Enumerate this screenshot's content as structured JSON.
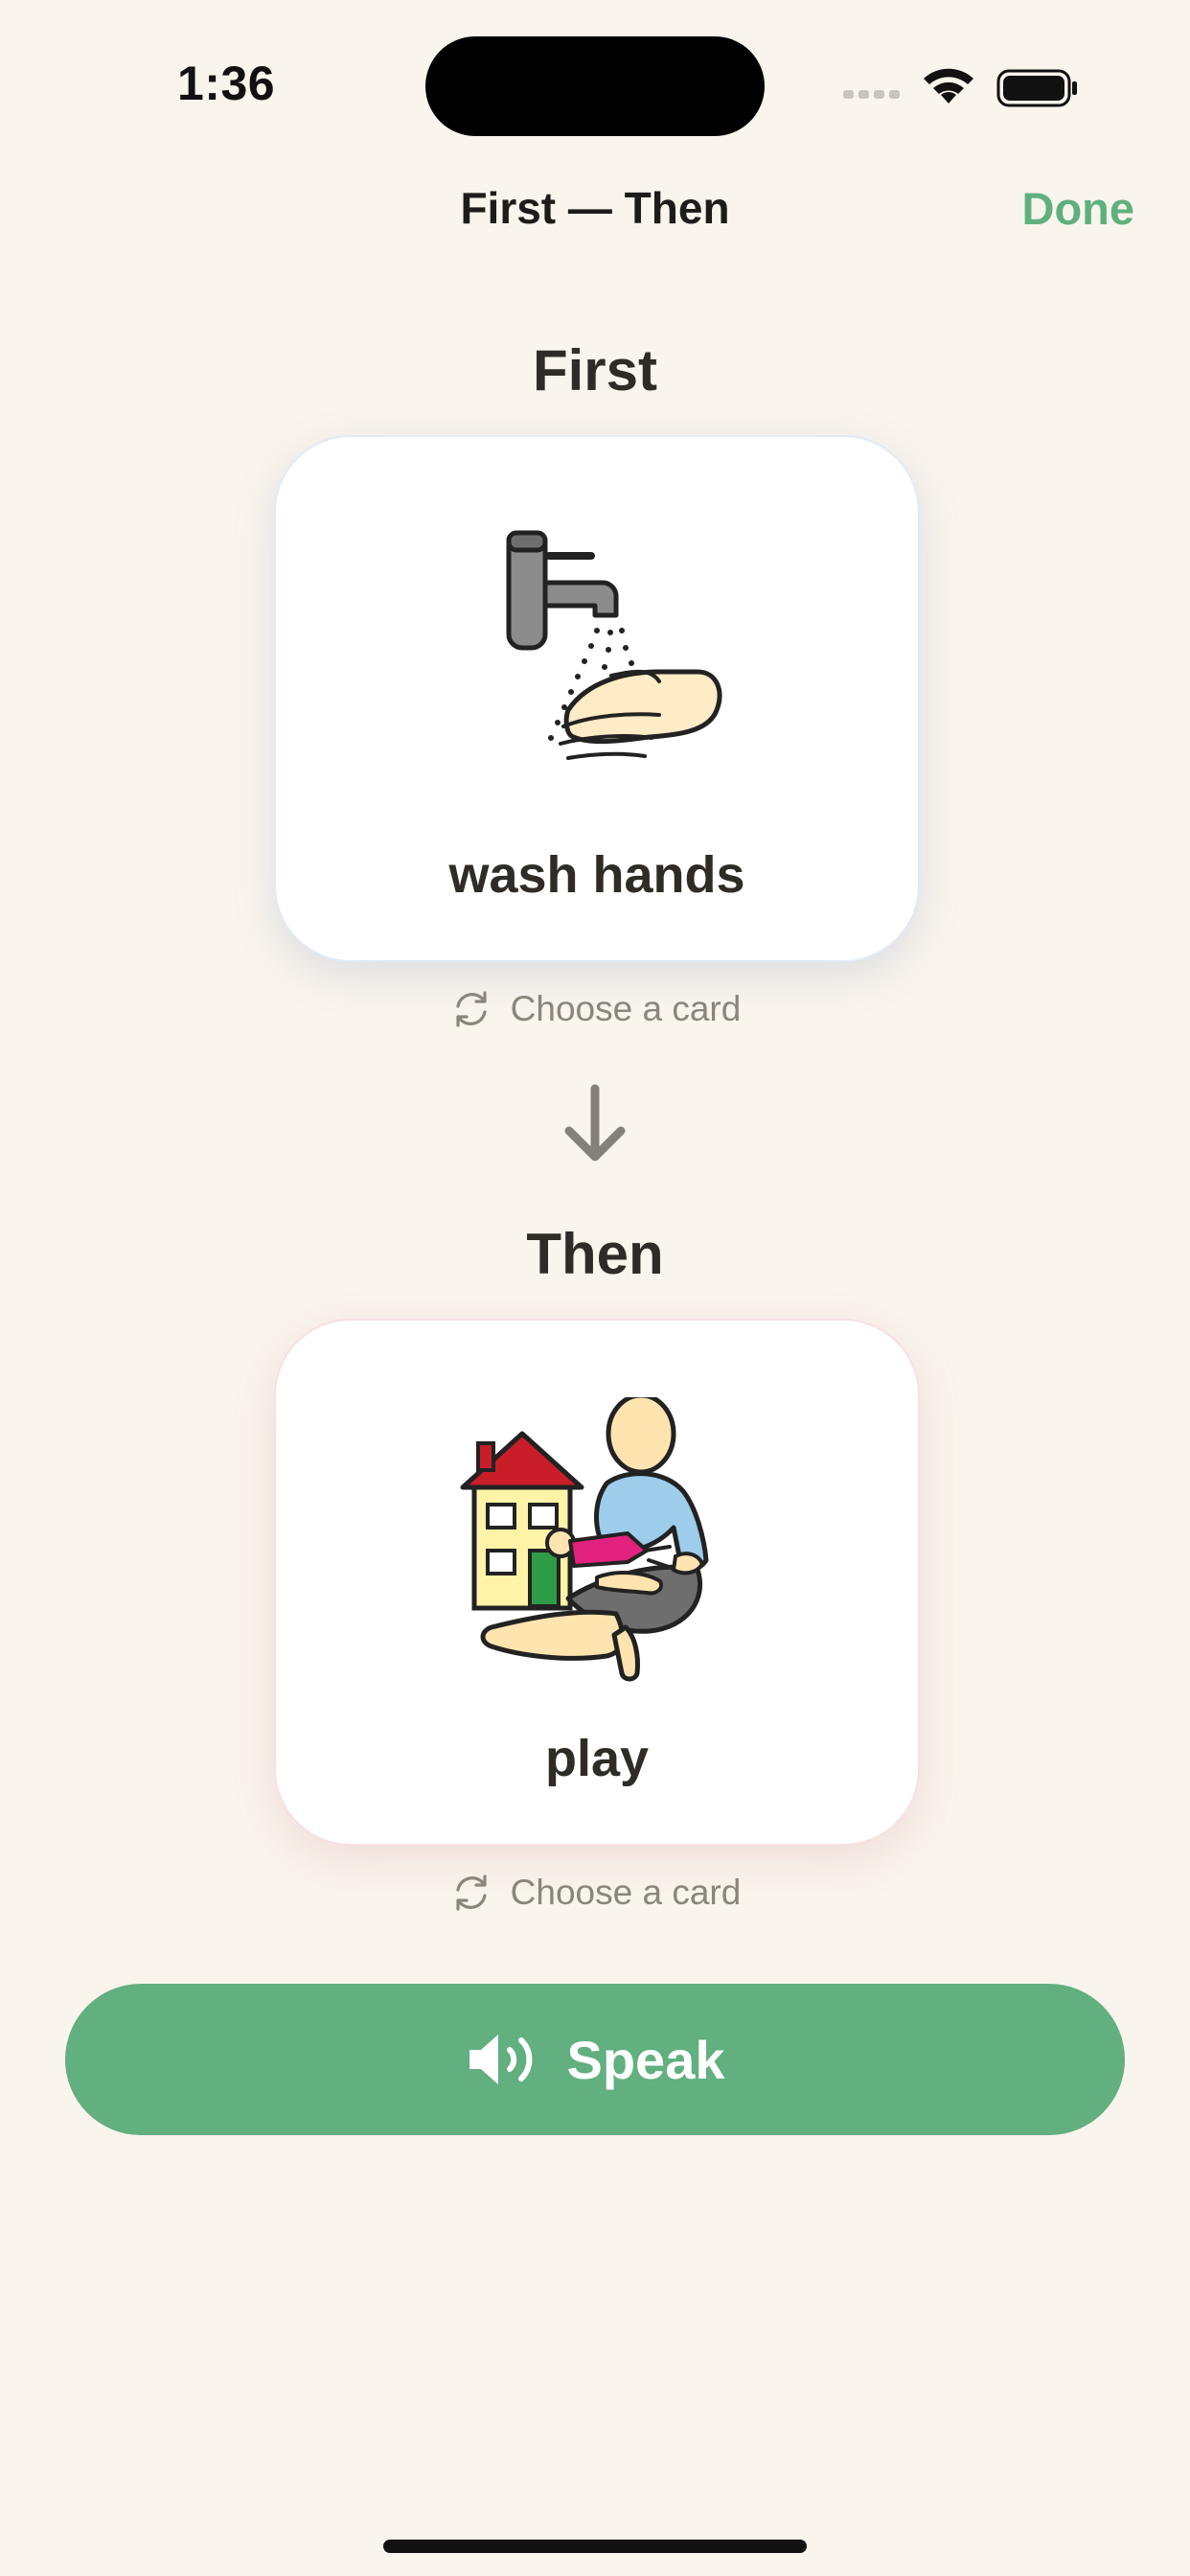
{
  "status_bar": {
    "time": "1:36"
  },
  "nav": {
    "title": "First — Then",
    "done_label": "Done"
  },
  "first": {
    "heading": "First",
    "card_label": "wash hands",
    "choose_label": "Choose a card",
    "image_icon": "wash-hands-pictogram"
  },
  "then": {
    "heading": "Then",
    "card_label": "play",
    "choose_label": "Choose a card",
    "image_icon": "play-pictogram"
  },
  "speak": {
    "label": "Speak",
    "icon": "speaker-icon"
  },
  "colors": {
    "accent": "#5FB07E",
    "background": "#F9F4EC",
    "button": "#62AF7F"
  }
}
